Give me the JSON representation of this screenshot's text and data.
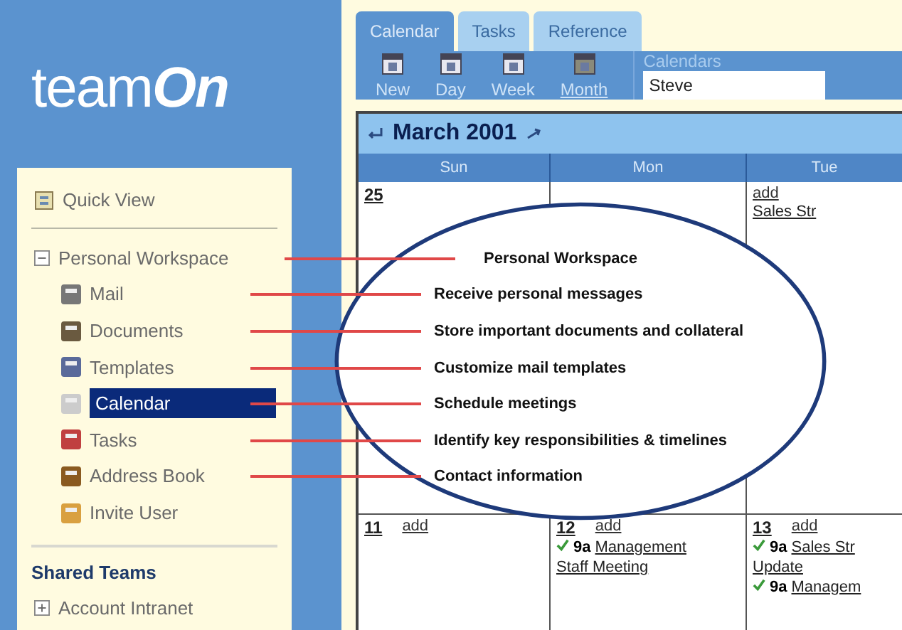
{
  "logo": {
    "text": "team",
    "accent": "On"
  },
  "sidebar": {
    "quick_view": {
      "label": "Quick View"
    },
    "workspace": {
      "label": "Personal Workspace",
      "expanded": true,
      "children": [
        {
          "label": "Mail",
          "selected": false
        },
        {
          "label": "Documents",
          "selected": false
        },
        {
          "label": "Templates",
          "selected": false
        },
        {
          "label": "Calendar",
          "selected": true
        },
        {
          "label": "Tasks",
          "selected": false
        },
        {
          "label": "Address Book",
          "selected": false
        },
        {
          "label": "Invite User",
          "selected": false
        }
      ]
    },
    "shared_teams": {
      "title": "Shared Teams",
      "items": [
        {
          "label": "Account Intranet",
          "expanded": false
        }
      ]
    }
  },
  "tabs": [
    {
      "label": "Calendar",
      "selected": true
    },
    {
      "label": "Tasks",
      "selected": false
    },
    {
      "label": "Reference",
      "selected": false
    }
  ],
  "toolbar": {
    "buttons": [
      {
        "label": "New",
        "selected": false
      },
      {
        "label": "Day",
        "selected": false
      },
      {
        "label": "Week",
        "selected": false
      },
      {
        "label": "Month",
        "selected": true
      }
    ],
    "calendars": {
      "label": "Calendars",
      "value": "Steve"
    }
  },
  "calendar": {
    "title": "March 2001",
    "columns": [
      "Sun",
      "Mon",
      "Tue"
    ],
    "rows": [
      [
        {
          "date": "25"
        },
        {},
        {
          "add": "add",
          "events": [
            {
              "title": "Sales Str"
            }
          ]
        }
      ],
      [
        {
          "date": "11",
          "add": "add"
        },
        {
          "date": "12",
          "add": "add",
          "events": [
            {
              "time": "9a",
              "title": "Management",
              "title_2": "Staff Meeting"
            }
          ]
        },
        {
          "date": "13",
          "add": "add",
          "events": [
            {
              "time": "9a",
              "title": "Sales Str",
              "title_2": "Update"
            },
            {
              "time": "9a",
              "title": "Managem"
            }
          ]
        }
      ]
    ]
  },
  "callouts": [
    {
      "text": "Personal Workspace"
    },
    {
      "text": "Receive personal messages"
    },
    {
      "text": "Store important documents and collateral"
    },
    {
      "text": "Customize mail templates"
    },
    {
      "text": "Schedule meetings"
    },
    {
      "text": "Identify key responsibilities & timelines"
    },
    {
      "text": "Contact information"
    }
  ]
}
